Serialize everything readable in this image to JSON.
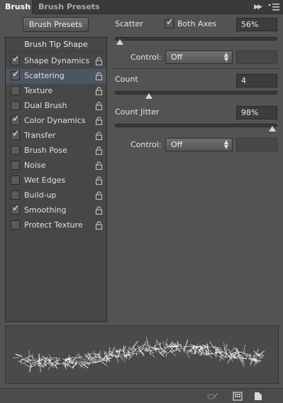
{
  "tabs": {
    "brush": "Brush",
    "brush_presets": "Brush Presets"
  },
  "left": {
    "presets_button": "Brush Presets",
    "tip_shape": "Brush Tip Shape",
    "options": [
      {
        "label": "Shape Dynamics",
        "checked": true,
        "selected": false
      },
      {
        "label": "Scattering",
        "checked": true,
        "selected": true
      },
      {
        "label": "Texture",
        "checked": false,
        "selected": false
      },
      {
        "label": "Dual Brush",
        "checked": false,
        "selected": false
      },
      {
        "label": "Color Dynamics",
        "checked": true,
        "selected": false
      },
      {
        "label": "Transfer",
        "checked": true,
        "selected": false
      },
      {
        "label": "Brush Pose",
        "checked": false,
        "selected": false
      },
      {
        "label": "Noise",
        "checked": false,
        "selected": false
      },
      {
        "label": "Wet Edges",
        "checked": false,
        "selected": false
      },
      {
        "label": "Build-up",
        "checked": false,
        "selected": false
      },
      {
        "label": "Smoothing",
        "checked": true,
        "selected": false
      },
      {
        "label": "Protect Texture",
        "checked": false,
        "selected": false
      }
    ]
  },
  "scatter": {
    "label": "Scatter",
    "both_axes_label": "Both Axes",
    "both_axes_checked": true,
    "value": "56%",
    "slider_fraction": 0.02,
    "control_label": "Control:",
    "control_value": "Off"
  },
  "count": {
    "label": "Count",
    "value": "4",
    "slider_fraction": 0.2
  },
  "count_jitter": {
    "label": "Count Jitter",
    "value": "98%",
    "slider_fraction": 0.98,
    "control_label": "Control:",
    "control_value": "Off"
  },
  "colors": {
    "panel": "#535353",
    "selected_row": "#4c5661"
  }
}
